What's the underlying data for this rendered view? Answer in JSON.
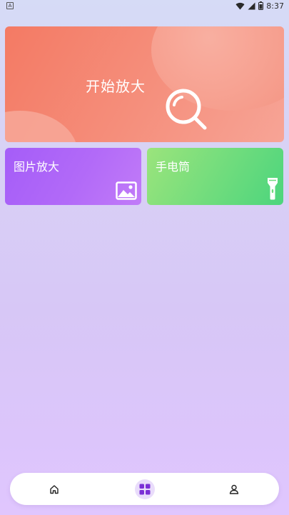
{
  "status_bar": {
    "notification_icon": "A",
    "time": "8:37",
    "icons": [
      "wifi-icon",
      "signal-icon",
      "battery-icon"
    ]
  },
  "hero": {
    "title": "开始放大",
    "icon": "magnifier-icon",
    "color": "#f47a64"
  },
  "cards": {
    "image_zoom": {
      "title": "图片放大",
      "icon": "picture-icon",
      "color": "#a55df8"
    },
    "flashlight": {
      "title": "手电筒",
      "icon": "flashlight-icon",
      "color": "#6fdc7d"
    }
  },
  "bottom_nav": {
    "items": [
      {
        "icon": "home-icon",
        "active": false
      },
      {
        "icon": "apps-grid-icon",
        "active": true
      },
      {
        "icon": "user-icon",
        "active": false
      }
    ],
    "accent_color": "#7b2fd6"
  }
}
